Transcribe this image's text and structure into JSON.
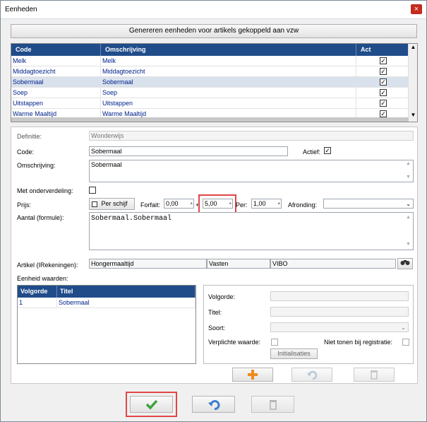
{
  "window": {
    "title": "Eenheden",
    "close_label": "×"
  },
  "toolbar": {
    "generate_label": "Genereren eenheden voor artikels gekoppeld aan vzw"
  },
  "grid": {
    "columns": [
      "Code",
      "Omschrijving",
      "Act"
    ],
    "rows": [
      {
        "code": "Melk",
        "description": "Melk",
        "active": "✓"
      },
      {
        "code": "Middagtoezicht",
        "description": "Middagtoezicht",
        "active": "✓"
      },
      {
        "code": "Sobermaal",
        "description": "Sobermaal",
        "active": "✓"
      },
      {
        "code": "Soep",
        "description": "Soep",
        "active": "✓"
      },
      {
        "code": "Uitstappen",
        "description": "Uitstappen",
        "active": "✓"
      },
      {
        "code": "Warme Maaltijd",
        "description": "Warme Maaltijd",
        "active": "✓"
      }
    ],
    "selected_index": 2
  },
  "form": {
    "definitie_label": "Definitie:",
    "definitie_value": "Wonderwijs",
    "code_label": "Code:",
    "code_value": "Sobermaal",
    "actief_label": "Actief:",
    "actief_check": "✓",
    "omschrijving_label": "Omschrijving:",
    "omschrijving_value": "Sobermaal",
    "onderverdeling_label": "Met onderverdeling:",
    "prijs_label": "Prijs:",
    "per_schijf_label": "Per schijf",
    "forfait_label": "Forfait:",
    "forfait_value": "0,00",
    "plus_label": "+",
    "plus_value": "5,00",
    "per_label": "Per:",
    "per_value": "1,00",
    "afronding_label": "Afronding:",
    "aantal_label": "Aantal (formule):",
    "aantal_value": "Sobermaal.Sobermaal",
    "artikel_label": "Artikel (IRekeningen):",
    "artikel_values": [
      "Hongermaaltijd",
      "Vasten",
      "VIBO"
    ],
    "eenheid_label": "Eenheid waarden:"
  },
  "values_grid": {
    "columns": [
      "Volgorde",
      "Titel"
    ],
    "rows": [
      {
        "order": "1",
        "title": "Sobermaal"
      }
    ]
  },
  "detail": {
    "volgorde_label": "Volgorde:",
    "titel_label": "Titel:",
    "soort_label": "Soort:",
    "verplicht_label": "Verplichte waarde:",
    "niet_tonen_label": "Niet tonen bij registratie:",
    "initialisaties_label": "Initialisaties"
  },
  "icons": {
    "add": "plus-icon",
    "undo": "undo-icon",
    "delete": "delete-icon",
    "confirm": "checkmark-icon",
    "search": "binoculars-icon"
  },
  "colors": {
    "header": "#204c8a",
    "highlight": "#e04646",
    "confirm": "#3aa33a",
    "add": "#f08a1c"
  }
}
